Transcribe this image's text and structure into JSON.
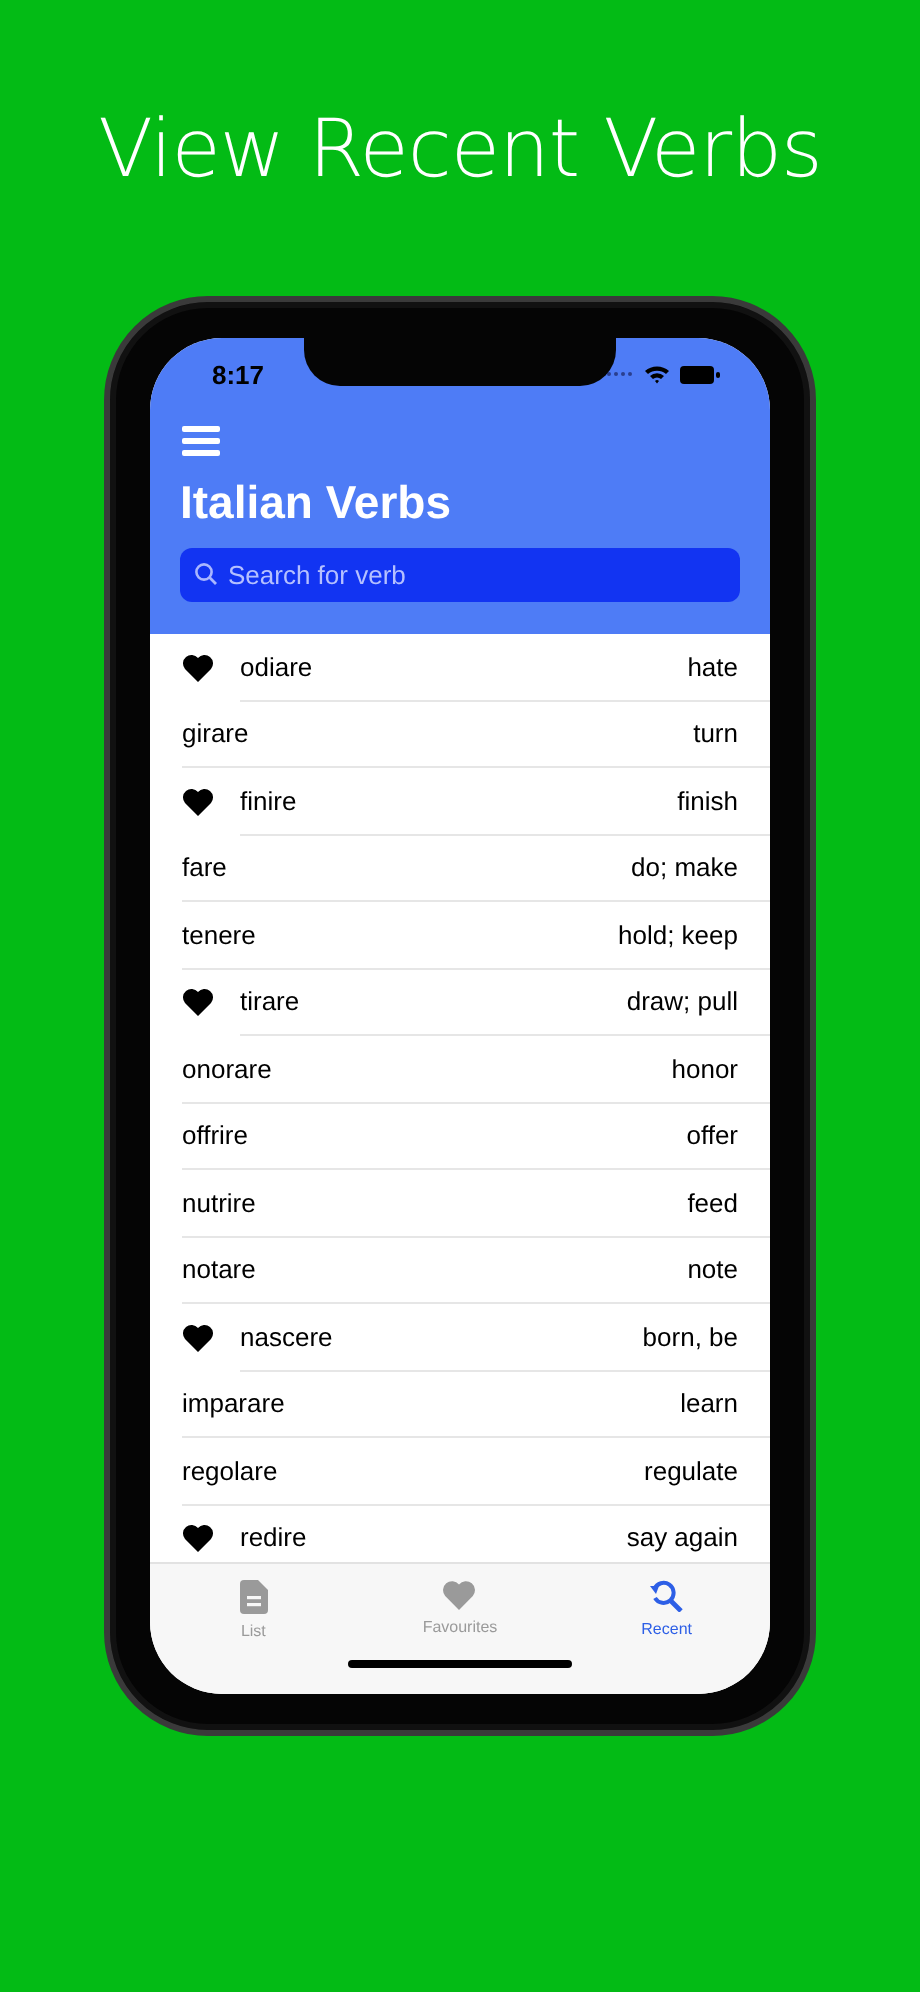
{
  "headline": "View Recent Verbs",
  "status_bar": {
    "time": "8:17"
  },
  "header": {
    "title": "Italian Verbs",
    "search": {
      "placeholder": "Search for verb"
    }
  },
  "verbs": [
    {
      "favourite": true,
      "italian": "odiare",
      "english": "hate"
    },
    {
      "favourite": false,
      "italian": "girare",
      "english": "turn"
    },
    {
      "favourite": true,
      "italian": "finire",
      "english": "finish"
    },
    {
      "favourite": false,
      "italian": "fare",
      "english": "do; make"
    },
    {
      "favourite": false,
      "italian": "tenere",
      "english": "hold; keep"
    },
    {
      "favourite": true,
      "italian": "tirare",
      "english": "draw; pull"
    },
    {
      "favourite": false,
      "italian": "onorare",
      "english": "honor"
    },
    {
      "favourite": false,
      "italian": "offrire",
      "english": "offer"
    },
    {
      "favourite": false,
      "italian": "nutrire",
      "english": "feed"
    },
    {
      "favourite": false,
      "italian": "notare",
      "english": "note"
    },
    {
      "favourite": true,
      "italian": "nascere",
      "english": "born, be"
    },
    {
      "favourite": false,
      "italian": "imparare",
      "english": "learn"
    },
    {
      "favourite": false,
      "italian": "regolare",
      "english": "regulate"
    },
    {
      "favourite": true,
      "italian": "redire",
      "english": "say again"
    }
  ],
  "tab_bar": [
    {
      "kind": "list",
      "label": "List",
      "selected": false
    },
    {
      "kind": "favourites",
      "label": "Favourites",
      "selected": false
    },
    {
      "kind": "recent",
      "label": "Recent",
      "selected": true
    }
  ]
}
